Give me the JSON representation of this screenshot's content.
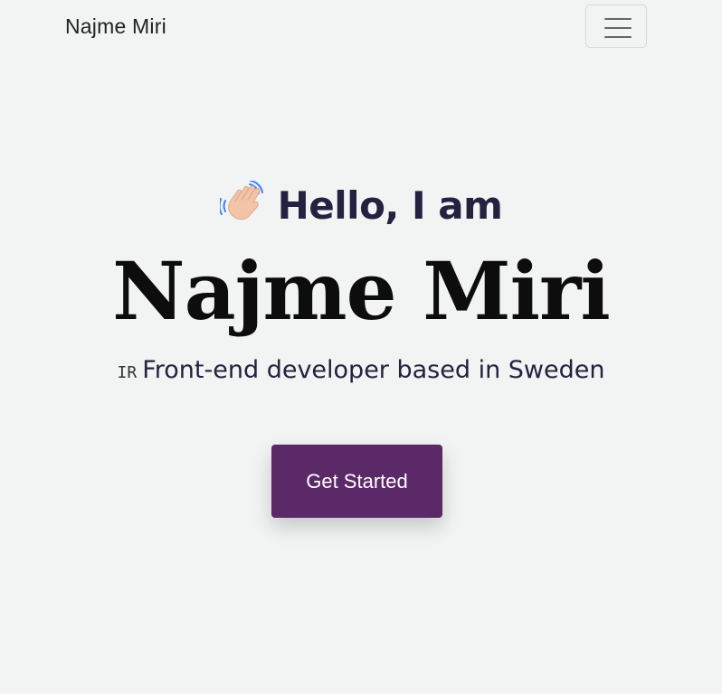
{
  "navbar": {
    "brand": "Najme Miri",
    "toggle_icon": "hamburger-menu-icon"
  },
  "hero": {
    "wave_icon": "waving-hand-icon",
    "greeting": "Hello, I am",
    "name": "Najme Miri",
    "flag": "IR",
    "tagline": "Front-end developer based in Sweden",
    "cta_label": "Get Started"
  },
  "colors": {
    "background": "#f2f3f3",
    "accent": "#5b2968",
    "heading": "#232240"
  }
}
